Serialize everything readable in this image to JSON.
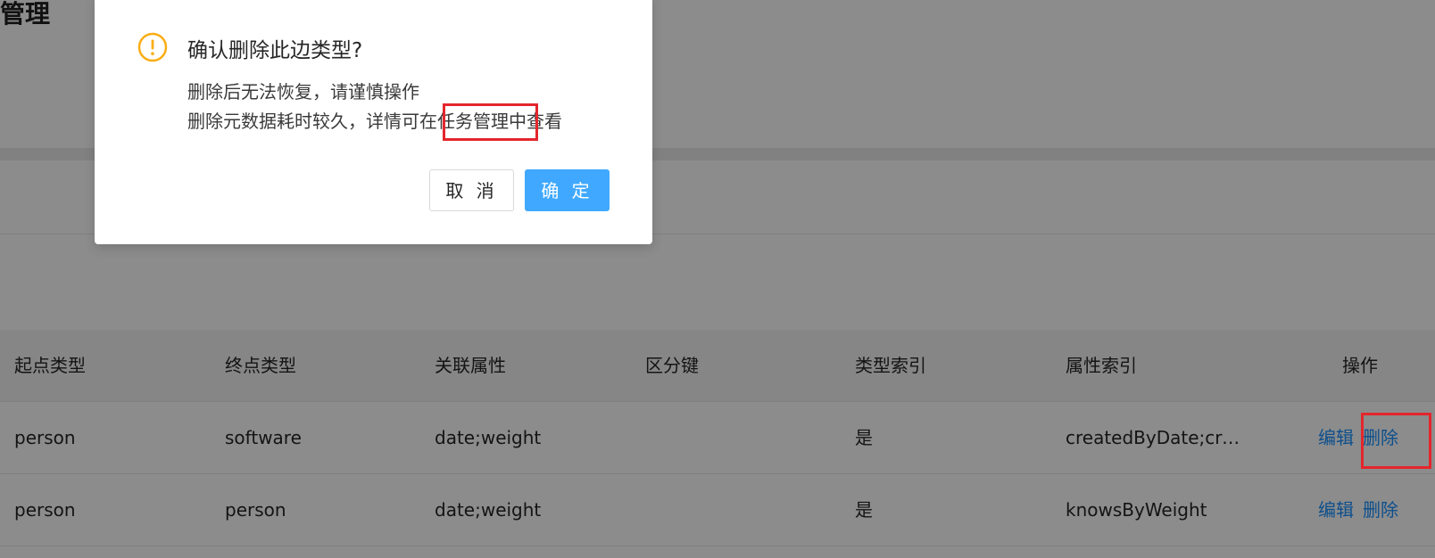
{
  "page": {
    "title": "据管理"
  },
  "table": {
    "columns": [
      "起点类型",
      "终点类型",
      "关联属性",
      "区分键",
      "类型索引",
      "属性索引",
      "操作"
    ],
    "rows": [
      {
        "source_type": "person",
        "target_type": "software",
        "linked_props": "date;weight",
        "partition_key": "",
        "type_index": "是",
        "prop_index": "createdByDate;cre...",
        "edit_label": "编辑",
        "delete_label": "删除"
      },
      {
        "source_type": "person",
        "target_type": "person",
        "linked_props": "date;weight",
        "partition_key": "",
        "type_index": "是",
        "prop_index": "knowsByWeight",
        "edit_label": "编辑",
        "delete_label": "删除"
      }
    ]
  },
  "modal": {
    "icon": "warning-circle-icon",
    "title": "确认删除此边类型?",
    "line1": "删除后无法恢复，请谨慎操作",
    "line2": "删除元数据耗时较久，详情可在任务管理中查看",
    "cancel_label": "取 消",
    "ok_label": "确 定"
  },
  "colors": {
    "overlay": "rgba(0,0,0,0.45)",
    "primary": "#40a9ff",
    "link": "#1890ff",
    "warning": "#faad14",
    "highlight": "#e4262c"
  }
}
